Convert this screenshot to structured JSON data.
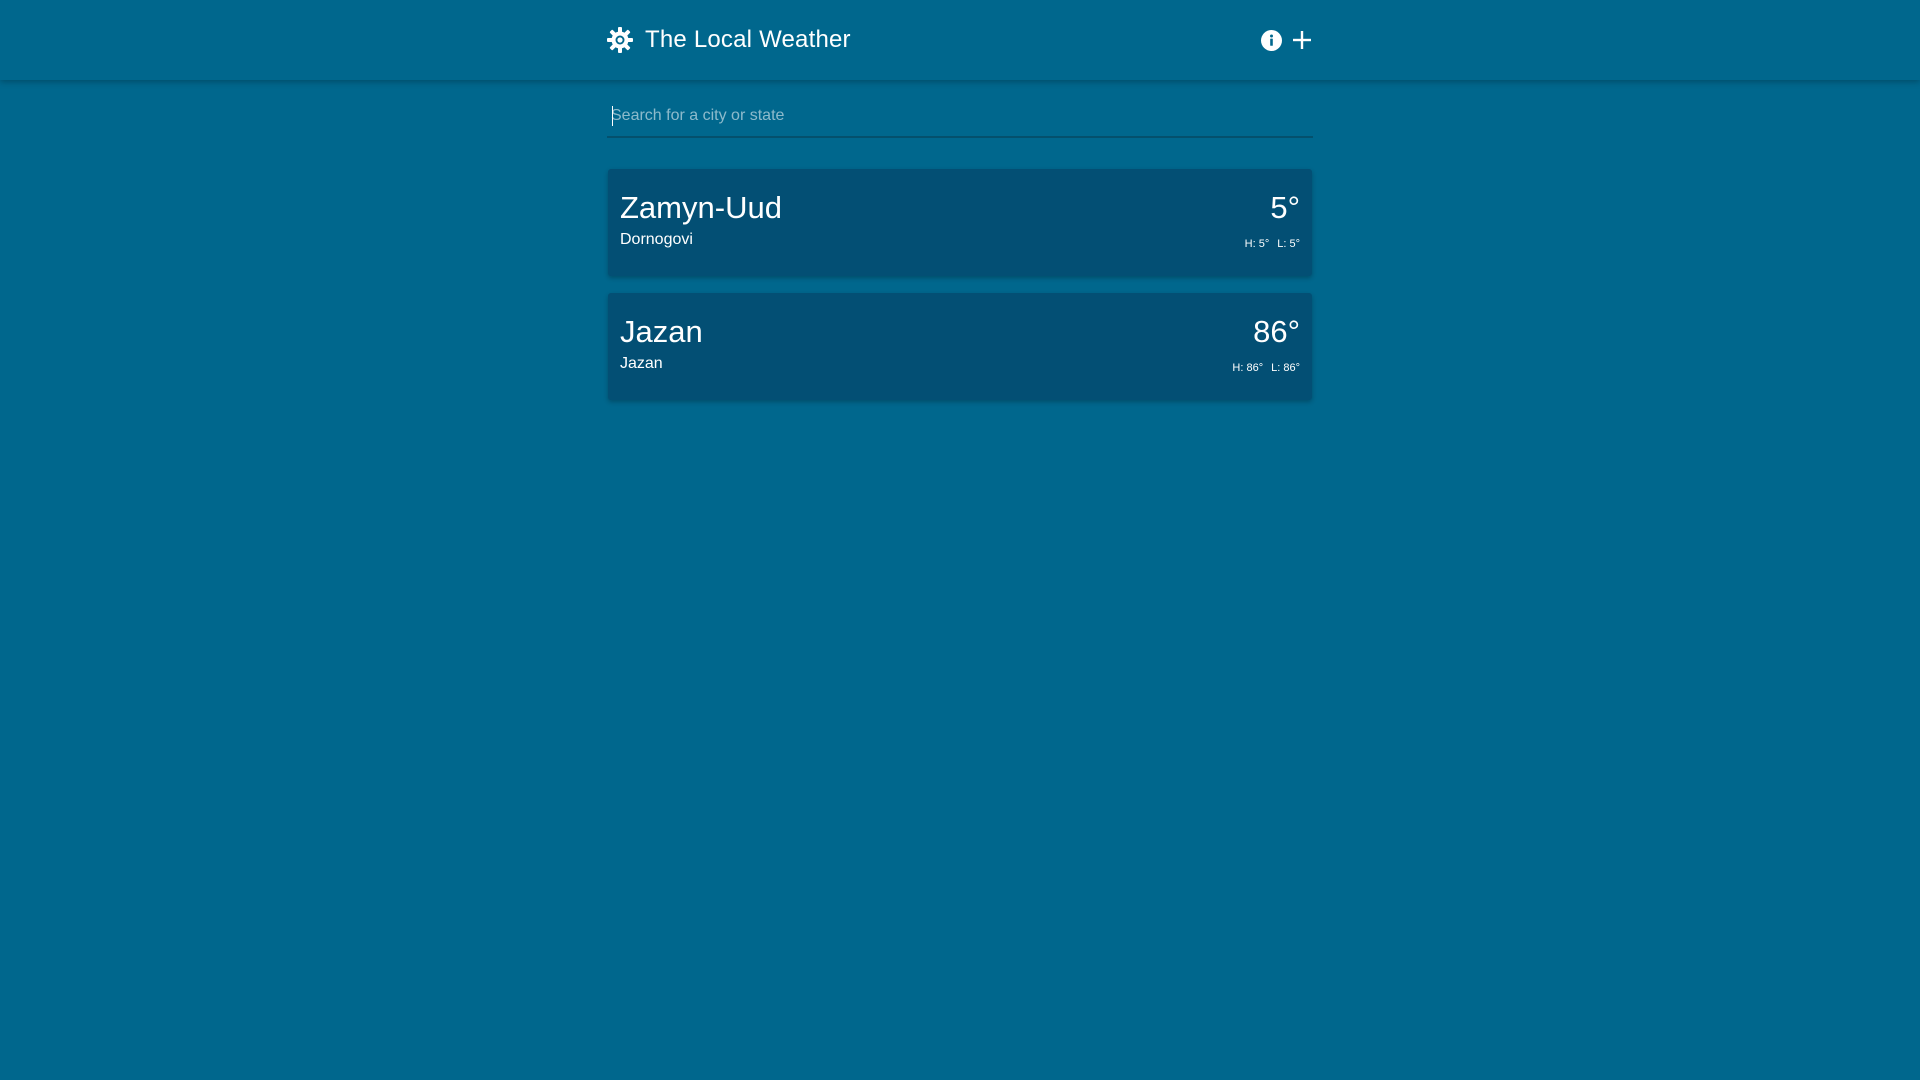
{
  "header": {
    "title": "The Local Weather",
    "logo_icon": "sun-icon",
    "actions": [
      {
        "name": "info",
        "icon": "info-icon"
      },
      {
        "name": "add",
        "icon": "plus-icon"
      }
    ]
  },
  "search": {
    "placeholder": "Search for a city or state",
    "value": ""
  },
  "cities": [
    {
      "name": "Zamyn-Uud",
      "region": "Dornogovi",
      "temp": "5°",
      "high": "H: 5°",
      "low": "L: 5°"
    },
    {
      "name": "Jazan",
      "region": "Jazan",
      "temp": "86°",
      "high": "H: 86°",
      "low": "L: 86°"
    }
  ],
  "colors": {
    "background": "#00678d",
    "card": "#034f74",
    "text": "#ffffff"
  }
}
